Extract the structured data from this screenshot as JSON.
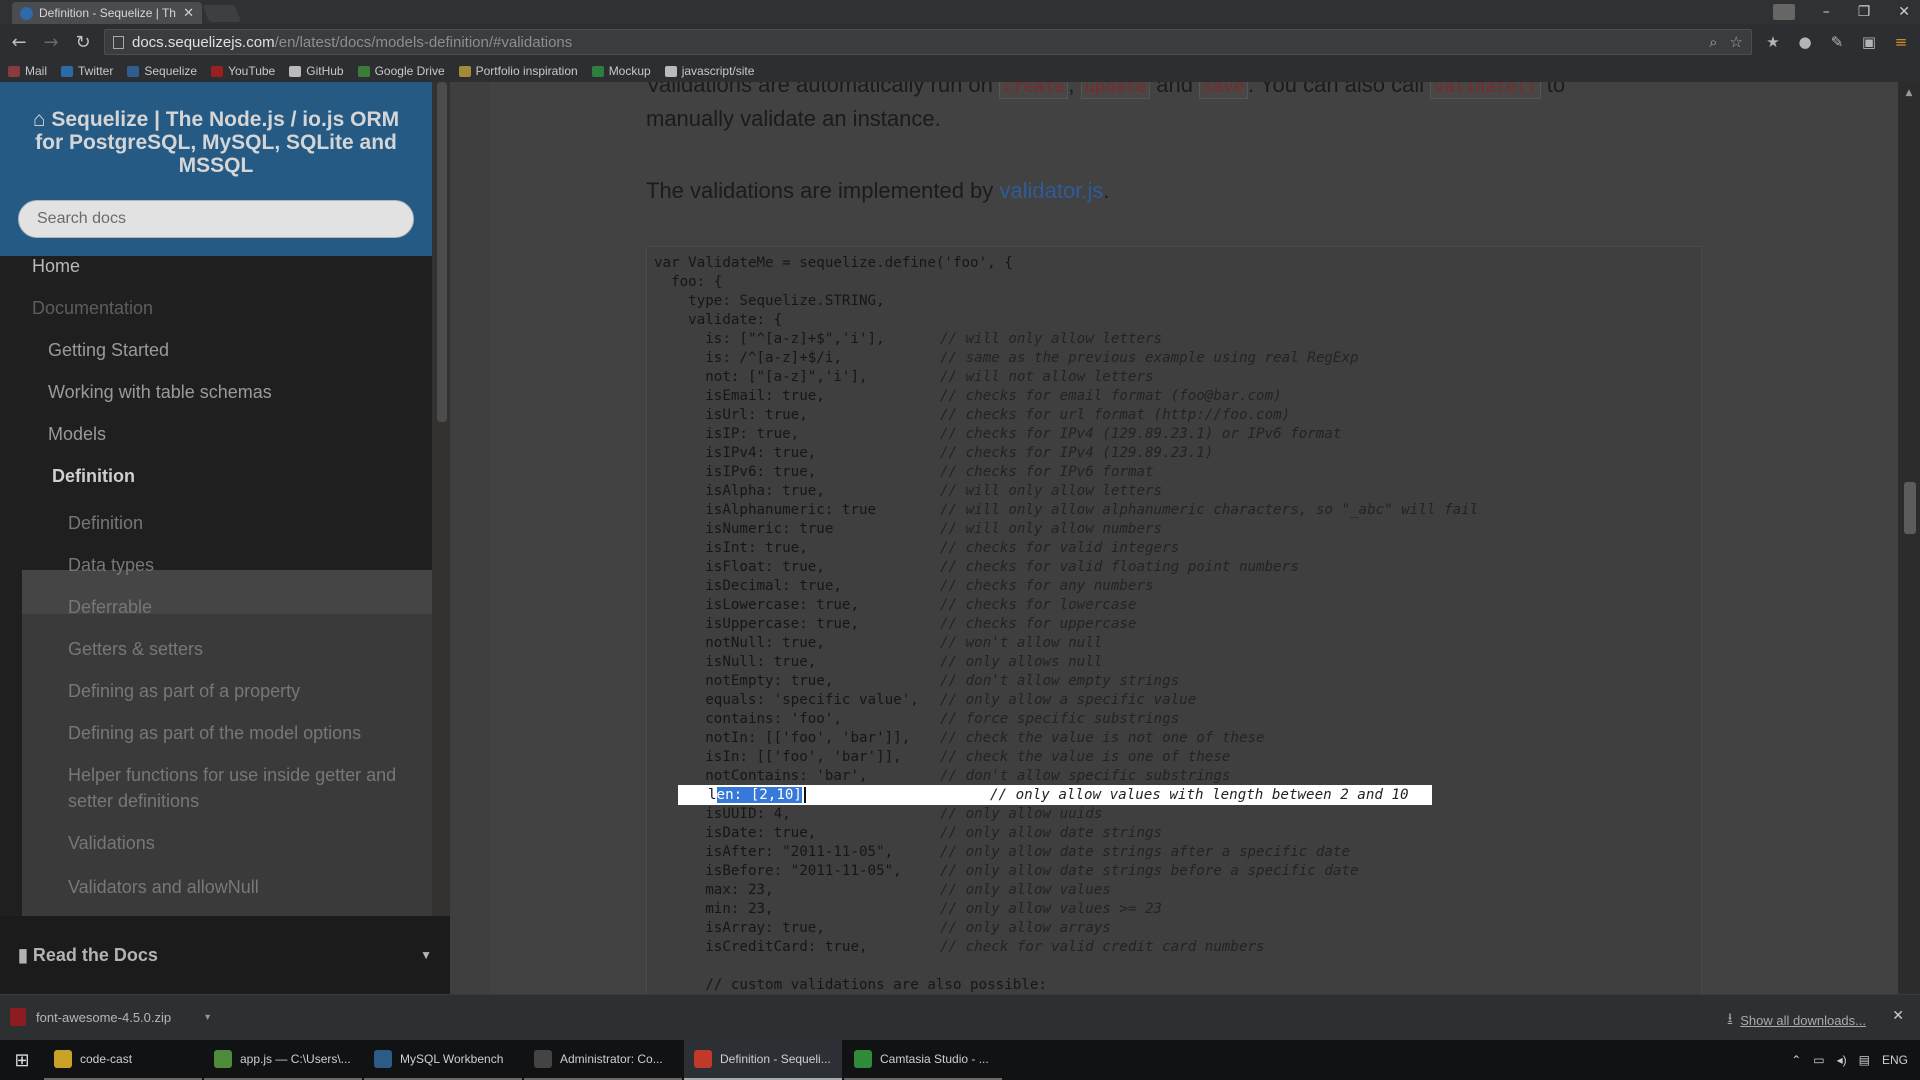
{
  "browser": {
    "tab_title": "Definition - Sequelize | Th",
    "url_host": "docs.sequelizejs.com",
    "url_path": "/en/latest/docs/models-definition/#validations",
    "bookmarks": [
      {
        "label": "Mail",
        "icon": "mail-icon",
        "color": "#8a3b3b"
      },
      {
        "label": "Twitter",
        "icon": "twitter-icon",
        "color": "#2a6aa6"
      },
      {
        "label": "Sequelize",
        "icon": "sequelize-icon",
        "color": "#2f5d8f"
      },
      {
        "label": "YouTube",
        "icon": "youtube-icon",
        "color": "#9b1f1f"
      },
      {
        "label": "GitHub",
        "icon": "github-icon",
        "color": "#bbbbbb"
      },
      {
        "label": "Google Drive",
        "icon": "google-drive-icon",
        "color": "#3a7d3a"
      },
      {
        "label": "Portfolio inspiration",
        "icon": "folder-icon",
        "color": "#a28a3a"
      },
      {
        "label": "Mockup",
        "icon": "mockup-icon",
        "color": "#2f7d3f"
      },
      {
        "label": "javascript/site",
        "icon": "github-icon",
        "color": "#bbbbbb"
      }
    ]
  },
  "sidebar": {
    "brand": "Sequelize | The Node.js / io.js ORM for PostgreSQL, MySQL, SQLite and MSSQL",
    "search_placeholder": "Search docs",
    "items": [
      {
        "label": "Home",
        "kind": "home"
      },
      {
        "label": "Documentation",
        "kind": "section"
      },
      {
        "label": "Getting Started",
        "kind": "level1"
      },
      {
        "label": "Working with table schemas",
        "kind": "level1"
      },
      {
        "label": "Models",
        "kind": "level1"
      },
      {
        "label": "Definition",
        "kind": "current"
      },
      {
        "label": "Definition",
        "kind": "sub"
      },
      {
        "label": "Data types",
        "kind": "sub"
      },
      {
        "label": "Deferrable",
        "kind": "sub"
      },
      {
        "label": "Getters & setters",
        "kind": "sub"
      },
      {
        "label": "Defining as part of a property",
        "kind": "sub"
      },
      {
        "label": "Defining as part of the model options",
        "kind": "sub"
      },
      {
        "label": "Helper functions for use inside getter and setter definitions",
        "kind": "sub"
      },
      {
        "label": "Validations",
        "kind": "sub"
      },
      {
        "label": "Validators and allowNull",
        "kind": "sub"
      }
    ],
    "read_the_docs": "Read the Docs"
  },
  "content": {
    "para1": {
      "prefix": "Validations are automatically run on",
      "code1": "create",
      "code2": "update",
      "and": "and",
      "code3": "save",
      "suffix": ". You can also call",
      "code4": "validate()",
      "to": "to",
      "line2": "manually validate an instance."
    },
    "para2": {
      "prefix": "The validations are implemented by",
      "link": "validator.js",
      "suffix": "."
    },
    "code_lines": [
      {
        "code": "var ValidateMe = sequelize.define('foo', {",
        "comment": ""
      },
      {
        "code": "  foo: {",
        "comment": ""
      },
      {
        "code": "    type: Sequelize.STRING,",
        "comment": ""
      },
      {
        "code": "    validate: {",
        "comment": ""
      },
      {
        "code": "      is: [\"^[a-z]+$\",'i'],",
        "comment": "// will only allow letters"
      },
      {
        "code": "      is: /^[a-z]+$/i,",
        "comment": "// same as the previous example using real RegExp"
      },
      {
        "code": "      not: [\"[a-z]\",'i'],",
        "comment": "// will not allow letters"
      },
      {
        "code": "      isEmail: true,",
        "comment": "// checks for email format (foo@bar.com)"
      },
      {
        "code": "      isUrl: true,",
        "comment": "// checks for url format (http://foo.com)"
      },
      {
        "code": "      isIP: true,",
        "comment": "// checks for IPv4 (129.89.23.1) or IPv6 format"
      },
      {
        "code": "      isIPv4: true,",
        "comment": "// checks for IPv4 (129.89.23.1)"
      },
      {
        "code": "      isIPv6: true,",
        "comment": "// checks for IPv6 format"
      },
      {
        "code": "      isAlpha: true,",
        "comment": "// will only allow letters"
      },
      {
        "code": "      isAlphanumeric: true",
        "comment": "// will only allow alphanumeric characters, so \"_abc\" will fail"
      },
      {
        "code": "      isNumeric: true",
        "comment": "// will only allow numbers"
      },
      {
        "code": "      isInt: true,",
        "comment": "// checks for valid integers"
      },
      {
        "code": "      isFloat: true,",
        "comment": "// checks for valid floating point numbers"
      },
      {
        "code": "      isDecimal: true,",
        "comment": "// checks for any numbers"
      },
      {
        "code": "      isLowercase: true,",
        "comment": "// checks for lowercase"
      },
      {
        "code": "      isUppercase: true,",
        "comment": "// checks for uppercase"
      },
      {
        "code": "      notNull: true,",
        "comment": "// won't allow null"
      },
      {
        "code": "      isNull: true,",
        "comment": "// only allows null"
      },
      {
        "code": "      notEmpty: true,",
        "comment": "// don't allow empty strings"
      },
      {
        "code": "      equals: 'specific value',",
        "comment": "// only allow a specific value"
      },
      {
        "code": "      contains: 'foo',",
        "comment": "// force specific substrings"
      },
      {
        "code": "      notIn: [['foo', 'bar']],",
        "comment": "// check the value is not one of these"
      },
      {
        "code": "      isIn: [['foo', 'bar']],",
        "comment": "// check the value is one of these"
      },
      {
        "code": "      notContains: 'bar',",
        "comment": "// don't allow specific substrings"
      },
      {
        "code": "",
        "comment": ""
      },
      {
        "code": "      isUUID: 4,",
        "comment": "// only allow uuids"
      },
      {
        "code": "      isDate: true,",
        "comment": "// only allow date strings"
      },
      {
        "code": "      isAfter: \"2011-11-05\",",
        "comment": "// only allow date strings after a specific date"
      },
      {
        "code": "      isBefore: \"2011-11-05\",",
        "comment": "// only allow date strings before a specific date"
      },
      {
        "code": "      max: 23,",
        "comment": "// only allow values"
      },
      {
        "code": "      min: 23,",
        "comment": "// only allow values >= 23"
      },
      {
        "code": "      isArray: true,",
        "comment": "// only allow arrays"
      },
      {
        "code": "      isCreditCard: true,",
        "comment": "// check for valid credit card numbers"
      },
      {
        "code": "",
        "comment": ""
      },
      {
        "code": "      // custom validations are also possible:",
        "comment": ""
      }
    ],
    "highlighted": {
      "lead": "l",
      "selected": "en: [2,10]",
      "comment": "// only allow values with length between 2 and 10"
    }
  },
  "downloads": {
    "file": "font-awesome-4.5.0.zip",
    "show_all": "Show all downloads..."
  },
  "taskbar": {
    "items": [
      {
        "label": "code-cast",
        "color": "#c9a227"
      },
      {
        "label": "app.js — C:\\Users\\...",
        "color": "#4d8a3a"
      },
      {
        "label": "MySQL Workbench",
        "color": "#2b5b86"
      },
      {
        "label": "Administrator: Co...",
        "color": "#444444"
      },
      {
        "label": "Definition - Sequeli...",
        "color": "#c0392b"
      },
      {
        "label": "Camtasia Studio - ...",
        "color": "#2f8a3a"
      }
    ],
    "language": "ENG"
  }
}
